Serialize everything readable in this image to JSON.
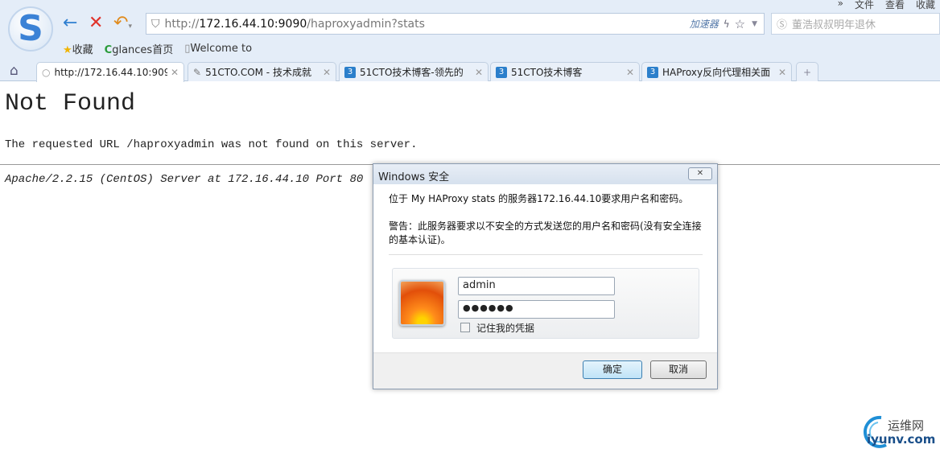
{
  "browser": {
    "menu": [
      "»",
      "文件",
      "查看",
      "收藏"
    ],
    "url_prefix": "http://",
    "url_host": "172.16.44.10:9090",
    "url_path": "/haproxyadmin?stats",
    "accelerator": "加速器",
    "search_placeholder": "董浩叔叔明年退休",
    "bookmarks": [
      {
        "label": "收藏",
        "icon": "star-icon"
      },
      {
        "label": "glances首页",
        "icon": "c-favicon"
      },
      {
        "label": "Welcome to",
        "icon": "page-icon"
      }
    ],
    "tabs": [
      {
        "label": "http://172.16.44.10:909",
        "active": true
      },
      {
        "label": "51CTO.COM - 技术成就"
      },
      {
        "label": "51CTO技术博客-领先的"
      },
      {
        "label": "51CTO技术博客"
      },
      {
        "label": "HAProxy反向代理相关面"
      }
    ],
    "new_tab": "+"
  },
  "page": {
    "title": "Not Found",
    "message": "The requested URL /haproxyadmin was not found on this server.",
    "address": "Apache/2.2.15 (CentOS) Server at 172.16.44.10 Port 80"
  },
  "dialog": {
    "title": "Windows 安全",
    "line1": "位于 My HAProxy stats 的服务器172.16.44.10要求用户名和密码。",
    "warn1": "警告：此服务器要求以不安全的方式发送您的用户名和密码(没有安全连接",
    "warn2": "的基本认证)。",
    "username": "admin",
    "password": "●●●●●●",
    "remember": "记住我的凭据",
    "remember_checked": false,
    "ok": "确定",
    "cancel": "取消"
  },
  "watermark": {
    "cn": "运维网",
    "en": "iyunv.com"
  }
}
